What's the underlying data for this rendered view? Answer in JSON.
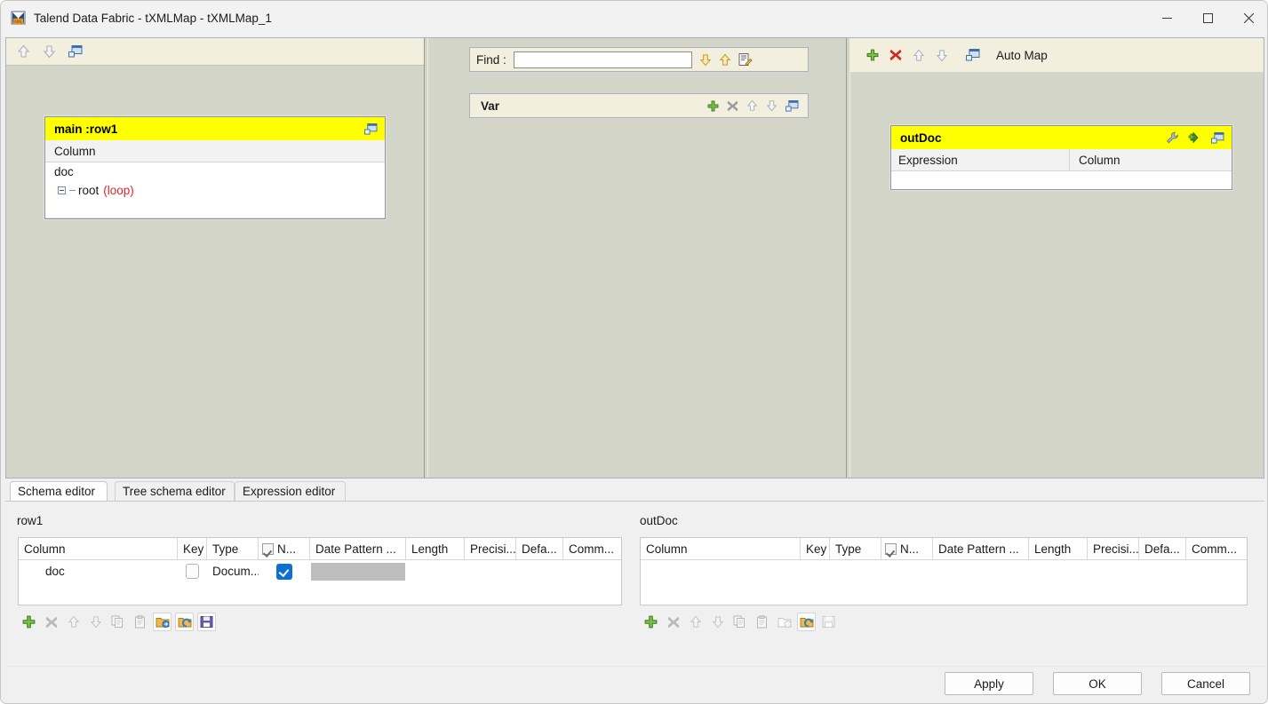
{
  "window": {
    "title": "Talend Data Fabric - tXMLMap - tXMLMap_1",
    "icon": "xml-map-icon",
    "controls": {
      "minimize": "—",
      "maximize": "☐",
      "close": "✕"
    }
  },
  "accent_colors": {
    "table_header_yellow": "#ffff00",
    "panel_background": "#d2d5c8",
    "toolbar_cream": "#f2efdf",
    "loop_red": "#e0262b",
    "checkbox_blue": "#0b6fd6",
    "plus_green": "#4ca32e",
    "delete_red": "#cf2b26"
  },
  "input_panel": {
    "toolbar_icons": [
      "up-arrow-icon",
      "down-arrow-icon",
      "minimize-panel-icon"
    ],
    "table": {
      "name": "main :row1",
      "header_icons": [
        "minimize-table-icon"
      ],
      "column_header": "Column",
      "rows": [
        {
          "label": "doc",
          "indent": 0,
          "tree": false,
          "loop": ""
        },
        {
          "label": "root",
          "indent": 1,
          "tree": true,
          "loop": "(loop)"
        }
      ]
    }
  },
  "var_panel": {
    "find": {
      "label": "Find :",
      "value": "",
      "placeholder": "",
      "icons": [
        "find-next-down-icon",
        "find-previous-up-icon",
        "find-options-icon"
      ]
    },
    "var_table": {
      "name": "Var",
      "icons": [
        "add-icon",
        "delete-icon",
        "move-up-icon",
        "move-down-icon",
        "minimize-table-icon"
      ]
    }
  },
  "output_panel": {
    "toolbar_icons": [
      "add-output-icon",
      "delete-output-icon",
      "move-up-icon",
      "move-down-icon",
      "minimize-panel-icon"
    ],
    "auto_map_label": "Auto Map",
    "table": {
      "name": "outDoc",
      "header_icons": [
        "settings-wrench-icon",
        "add-column-icon",
        "minimize-table-icon"
      ],
      "column_headers": [
        "Expression",
        "Column"
      ],
      "rows": []
    }
  },
  "bottom": {
    "tabs": [
      {
        "label": "Schema editor",
        "active": true
      },
      {
        "label": "Tree schema editor",
        "active": false
      },
      {
        "label": "Expression editor",
        "active": false
      }
    ],
    "left_schema": {
      "title": "row1",
      "columns": [
        "Column",
        "Key",
        "Type",
        "N...",
        "Date Pattern ...",
        "Length",
        "Precisi...",
        "Defa...",
        "Comm..."
      ],
      "nullable_header_checked": true,
      "rows": [
        {
          "column": "doc",
          "key_checked": false,
          "type": "Docum...",
          "nullable_checked": true,
          "date_pattern": "",
          "date_pattern_filled": true,
          "length": "",
          "precision": "",
          "default": "",
          "comment": ""
        }
      ],
      "toolbar_icons": [
        "add-row-icon",
        "delete-row-icon",
        "move-up-icon",
        "move-down-icon",
        "copy-icon",
        "paste-icon",
        "import-schema-icon",
        "export-schema-icon",
        "save-schema-icon"
      ],
      "toolbar_enabled": [
        true,
        false,
        false,
        false,
        false,
        false,
        true,
        true,
        true
      ]
    },
    "right_schema": {
      "title": "outDoc",
      "columns": [
        "Column",
        "Key",
        "Type",
        "N...",
        "Date Pattern ...",
        "Length",
        "Precisi...",
        "Defa...",
        "Comm..."
      ],
      "nullable_header_checked": true,
      "rows": [],
      "toolbar_icons": [
        "add-row-icon",
        "delete-row-icon",
        "move-up-icon",
        "move-down-icon",
        "copy-icon",
        "paste-icon",
        "import-schema-icon",
        "export-schema-icon",
        "save-schema-icon"
      ],
      "toolbar_enabled": [
        true,
        false,
        false,
        false,
        false,
        false,
        false,
        true,
        false
      ]
    }
  },
  "footer": {
    "apply": "Apply",
    "ok": "OK",
    "cancel": "Cancel"
  }
}
